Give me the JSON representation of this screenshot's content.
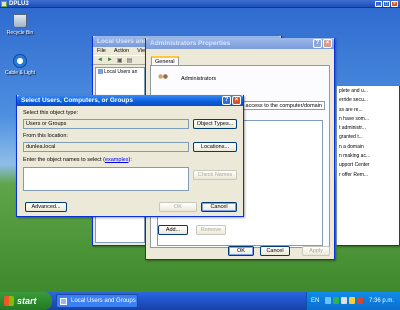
{
  "session": {
    "title": "DPLU3"
  },
  "desktop": {
    "icons": [
      {
        "label": "Recycle Bin",
        "icon": "recycle-bin"
      },
      {
        "label": "Cable & Light",
        "icon": "cable-light"
      }
    ]
  },
  "lug_window": {
    "title": "Local Users and Groups",
    "menu": [
      "File",
      "Action",
      "View"
    ],
    "tree": [
      "Local Users an"
    ]
  },
  "admin_props": {
    "title": "Administrators Properties",
    "tab": "General",
    "group_name": "Administrators",
    "description": "ected access to the computer/domain",
    "buttons": {
      "add": "Add...",
      "remove": "Remove",
      "ok": "OK",
      "cancel": "Cancel",
      "apply": "Apply"
    }
  },
  "peek": {
    "lines": [
      "plete and u...",
      "erride secu...",
      "ss are re...",
      "n have som...",
      "t administr...",
      "granted t...",
      "n a domain",
      "n making ac...",
      "upport Center",
      "r offer Rem..."
    ]
  },
  "select_dialog": {
    "title": "Select Users, Computers, or Groups",
    "object_type_label": "Select this object type:",
    "object_type_value": "Users or Groups",
    "object_types_button": "Object Types...",
    "location_label": "From this location:",
    "location_value": "dunlea.local",
    "locations_button": "Locations...",
    "enter_label": "Enter the object names to select (",
    "examples_link": "examples",
    "enter_label_end": "):",
    "names_value": "",
    "check_names_button": "Check Names",
    "advanced_button": "Advanced...",
    "ok_button": "OK",
    "cancel_button": "Cancel"
  },
  "taskbar": {
    "start_label": "start",
    "task": "Local Users and Groups",
    "lang": "EN",
    "clock": "7:36 p.m."
  },
  "colors": {
    "xp_blue": "#0b5ddb",
    "start_green": "#2f8f2f",
    "close_red": "#d9542b"
  }
}
